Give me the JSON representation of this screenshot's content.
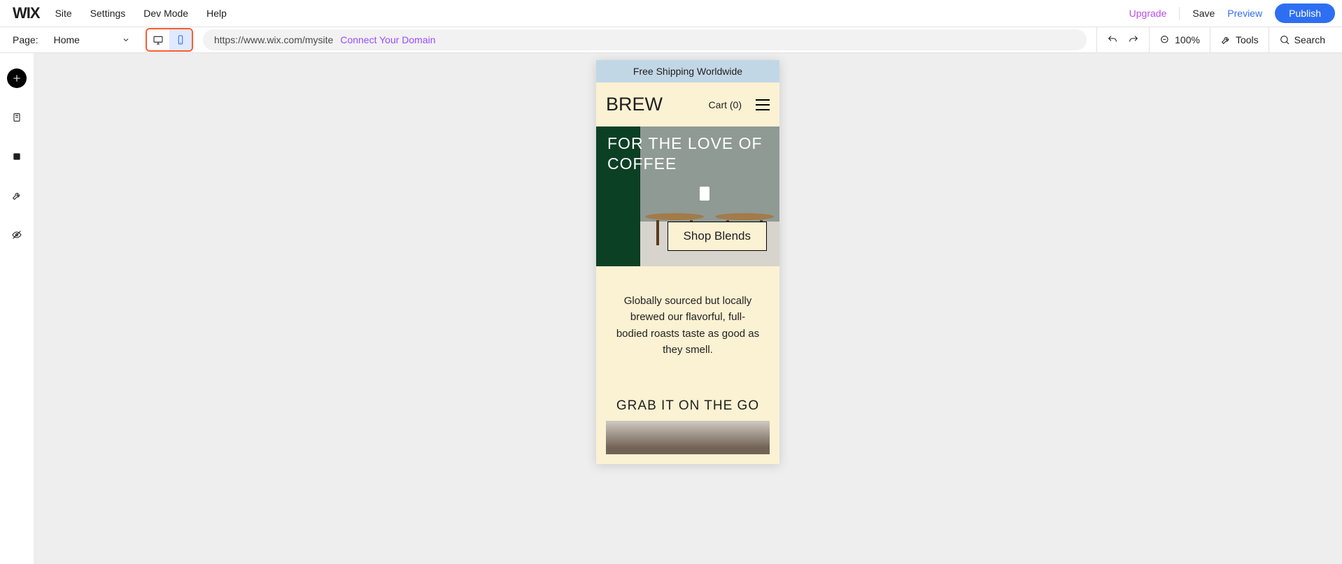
{
  "top_menu": {
    "site": "Site",
    "settings": "Settings",
    "dev": "Dev Mode",
    "help": "Help"
  },
  "top_right": {
    "upgrade": "Upgrade",
    "save": "Save",
    "preview": "Preview",
    "publish": "Publish"
  },
  "toolbar": {
    "page_label": "Page:",
    "page_name": "Home",
    "url": "https://www.wix.com/mysite",
    "url_cta": "Connect Your Domain",
    "zoom": "100%",
    "tools": "Tools",
    "search": "Search"
  },
  "device": {
    "active": "mobile"
  },
  "preview": {
    "banner": "Free Shipping Worldwide",
    "brand": "BREW",
    "cart": "Cart (0)",
    "hero_title": "FOR THE LOVE OF COFFEE",
    "cta": "Shop Blends",
    "intro": "Globally sourced but locally brewed our flavorful, full-bodied roasts taste as good as they smell.",
    "grab": "GRAB IT ON THE GO"
  }
}
